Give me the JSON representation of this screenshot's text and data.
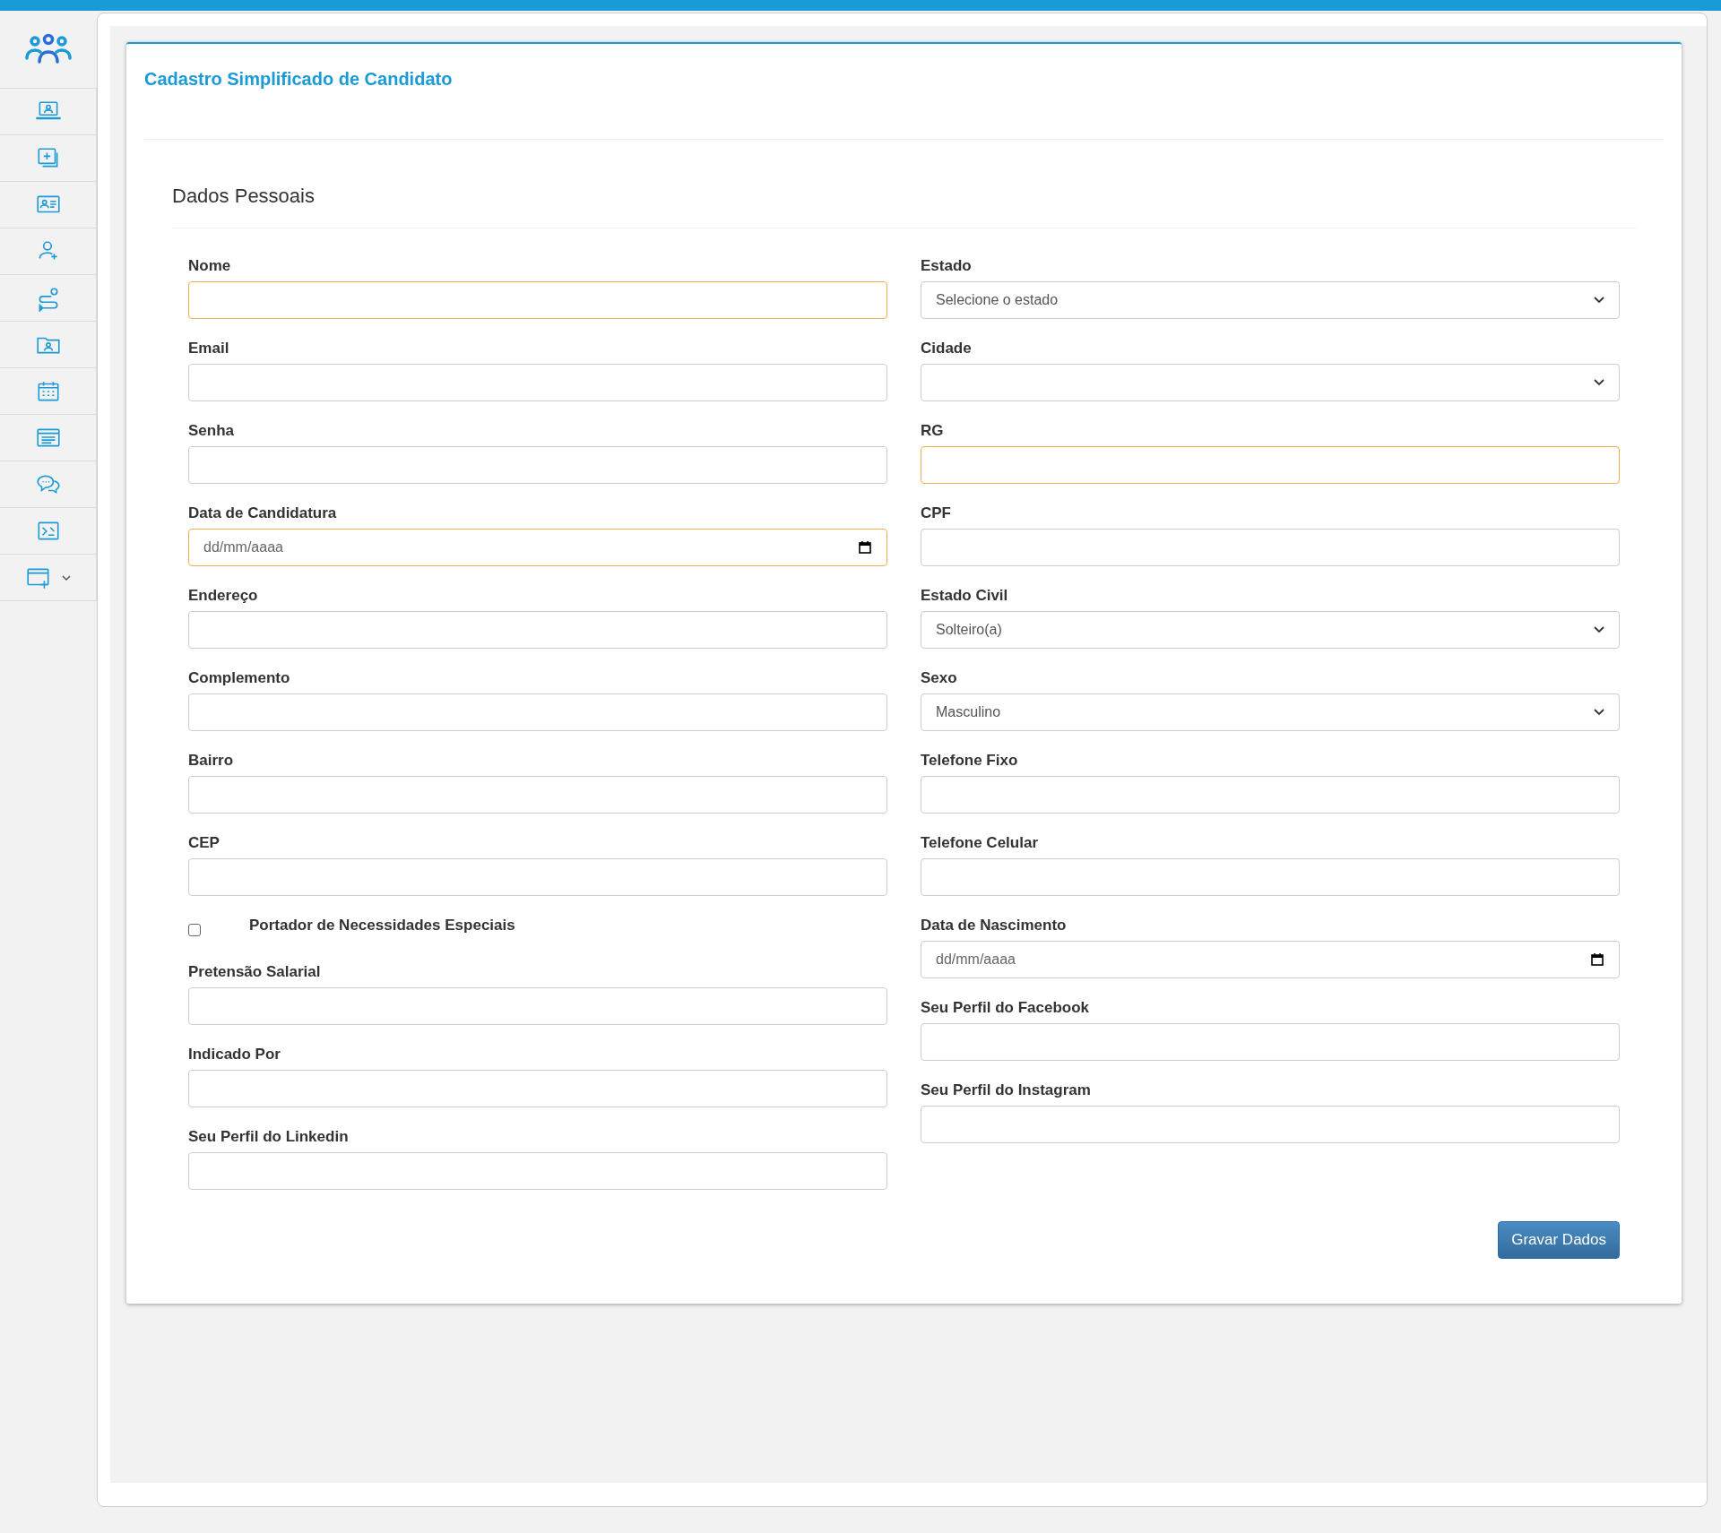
{
  "header": {
    "title": "Cadastro Simplificado de Candidato"
  },
  "section": {
    "title": "Dados Pessoais"
  },
  "sidebar": {
    "items": [
      {
        "expandable": false
      },
      {
        "expandable": false
      },
      {
        "expandable": false
      },
      {
        "expandable": false
      },
      {
        "expandable": false
      },
      {
        "expandable": false
      },
      {
        "expandable": false
      },
      {
        "expandable": false
      },
      {
        "expandable": false
      },
      {
        "expandable": false
      },
      {
        "expandable": true
      }
    ]
  },
  "left_fields": [
    {
      "kind": "text",
      "label": "Nome",
      "required": true
    },
    {
      "kind": "text",
      "label": "Email",
      "required": false
    },
    {
      "kind": "text",
      "label": "Senha",
      "required": false
    },
    {
      "kind": "date",
      "label": "Data de Candidatura",
      "placeholder": "dd/mm/aaaa",
      "required": true
    },
    {
      "kind": "text",
      "label": "Endereço",
      "required": false
    },
    {
      "kind": "text",
      "label": "Complemento",
      "required": false
    },
    {
      "kind": "text",
      "label": "Bairro",
      "required": false
    },
    {
      "kind": "text",
      "label": "CEP",
      "required": false
    },
    {
      "kind": "checkbox",
      "label": "Portador de Necessidades Especiais",
      "checked": false
    },
    {
      "kind": "text",
      "label": "Pretensão Salarial",
      "required": false
    },
    {
      "kind": "text",
      "label": "Indicado Por",
      "required": false
    },
    {
      "kind": "text",
      "label": "Seu Perfil do Linkedin",
      "required": false
    }
  ],
  "right_fields": [
    {
      "kind": "select",
      "label": "Estado",
      "value": "Selecione o estado",
      "required": false
    },
    {
      "kind": "select",
      "label": "Cidade",
      "required": false
    },
    {
      "kind": "text",
      "label": "RG",
      "required": true
    },
    {
      "kind": "text",
      "label": "CPF",
      "required": false
    },
    {
      "kind": "select",
      "label": "Estado Civil",
      "value": "Solteiro(a)",
      "required": false
    },
    {
      "kind": "select",
      "label": "Sexo",
      "value": "Masculino",
      "required": false
    },
    {
      "kind": "text",
      "label": "Telefone Fixo",
      "required": false
    },
    {
      "kind": "text",
      "label": "Telefone Celular",
      "required": false
    },
    {
      "kind": "date",
      "label": "Data de Nascimento",
      "placeholder": "dd/mm/aaaa",
      "required": false
    },
    {
      "kind": "text",
      "label": "Seu Perfil do Facebook",
      "required": false
    },
    {
      "kind": "text",
      "label": "Seu Perfil do Instagram",
      "required": false
    }
  ],
  "submit_button": "Gravar Dados"
}
